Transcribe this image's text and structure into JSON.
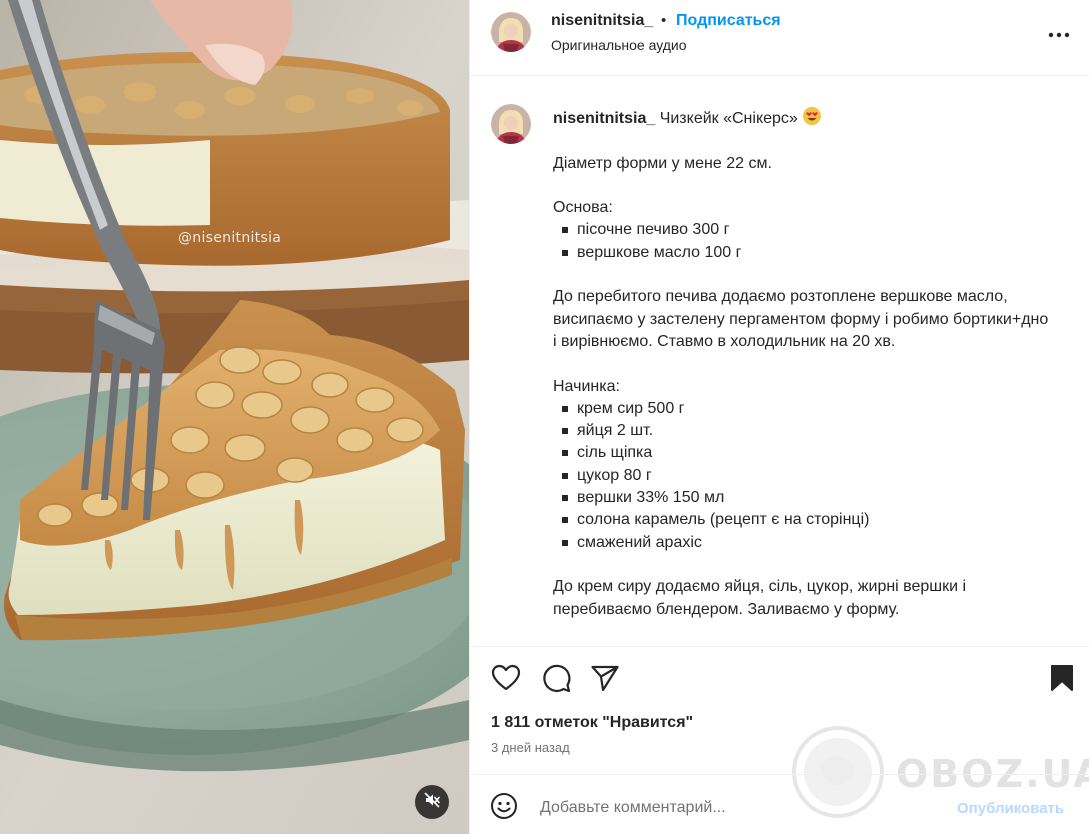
{
  "media": {
    "watermark": "@nisenitnitsia",
    "mute_icon": "speaker-muted-icon"
  },
  "header": {
    "username": "nisenitnitsia_",
    "separator": "•",
    "follow_label": "Подписаться",
    "audio_label": "Оригинальное аудио",
    "more_icon": "more-horizontal-icon"
  },
  "caption": {
    "username": "nisenitnitsia_",
    "title": "Чизкейк «Снікерс»",
    "title_emoji": "heart-eyes-emoji",
    "diameter": "Діаметр форми у мене 22 см.",
    "base_heading": "Основа:",
    "base_items": [
      "пісочне печиво 300 г",
      "вершкове масло 100 г"
    ],
    "base_instructions": "До перебитого печива додаємо розтоплене вершкове масло, висипаємо у застелену пергаментом форму і робимо бортики+дно і вирівнюємо. Ставмо в холодильник на 20 хв.",
    "filling_heading": "Начинка:",
    "filling_items": [
      "крем сир 500 г",
      "яйця 2 шт.",
      "сіль щіпка",
      "цукор 80 г",
      "вершки 33% 150 мл",
      "солона карамель (рецепт є на сторінці)",
      "смажений арахіс"
    ],
    "filling_instructions": "До крем сиру додаємо яйця, сіль, цукор, жирні вершки і перебиваємо блендером. Заливаємо у форму."
  },
  "actions": {
    "like_icon": "heart-icon",
    "comment_icon": "comment-bubble-icon",
    "share_icon": "paper-plane-icon",
    "save_icon": "bookmark-icon"
  },
  "likes_text": "1 811 отметок \"Нравится\"",
  "time_text": "3 дней назад",
  "comment": {
    "emoji_icon": "smiley-icon",
    "placeholder": "Добавьте комментарий...",
    "publish_label": "Опубликовать"
  },
  "site_watermark": "OBOZ.UA",
  "colors": {
    "link_blue": "#0095f6",
    "publish_disabled": "#b3dbff",
    "text": "#262626",
    "secondary_text": "#737373",
    "border": "#efefef"
  }
}
